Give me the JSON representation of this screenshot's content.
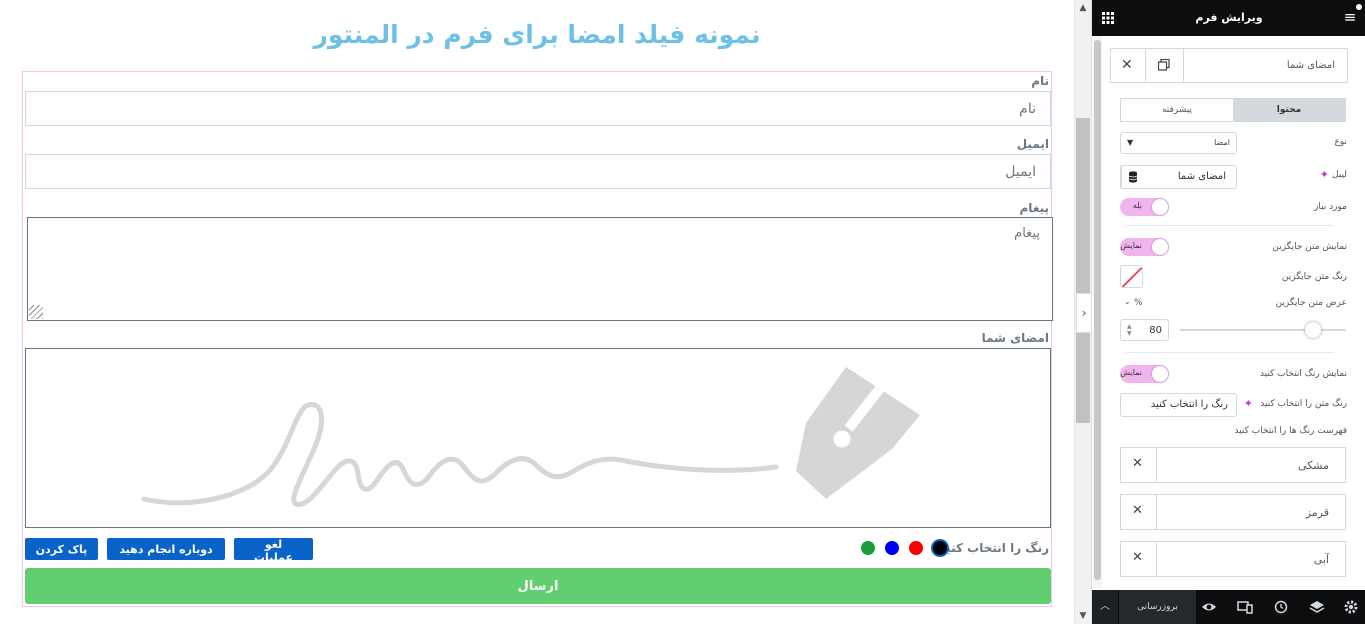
{
  "page": {
    "title": "نمونه فیلد امضا برای فرم در المنتور"
  },
  "form": {
    "name_label": "نام",
    "name_placeholder": "نام",
    "email_label": "ایمیل",
    "email_placeholder": "ایمیل",
    "message_label": "پیغام",
    "message_placeholder": "پیغام",
    "signature_label": "امضای شما",
    "choose_color_label": "رنگ را انتخاب کنید",
    "colors": [
      "#000000",
      "#ff0000",
      "#0000ff",
      "#1b9e3a"
    ],
    "undo_label": "لغو عملیات",
    "redo_label": "دوباره انجام دهید",
    "clear_label": "پاک کردن",
    "submit_label": "ارسال",
    "accent_title_color": "#6ec1e4",
    "submit_color": "#61ce70",
    "button_color": "#0a63c9"
  },
  "panel": {
    "header_title": "ویرایش فرم",
    "item_title": "امضای شما",
    "tabs": {
      "content": "محتوا",
      "advanced": "پیشرفته"
    },
    "fields": {
      "type_label": "نوع",
      "type_value": "امضا",
      "label_label": "لیبل",
      "label_value": "امضای شما",
      "required_label": "مورد نیاز",
      "required_toggle": "بله",
      "show_placeholder_label": "نمایش متن جایگزین",
      "show_placeholder_toggle": "نمایش",
      "placeholder_color_label": "رنگ متن جایگزین",
      "placeholder_width_label": "عرض متن جایگزین",
      "width_unit": "%",
      "width_value": "80",
      "width_percent": 80,
      "show_color_picker_label": "نمایش رنگ انتخاب کنید",
      "show_color_picker_toggle": "نمایش",
      "choose_color_text_label": "رنگ متن را انتخاب کنید",
      "choose_color_text_value": "رنگ را انتخاب کنید",
      "color_list_label": "فهرست رنگ ها را انتخاب کنید",
      "color_items": [
        "مشکی",
        "قرمز",
        "آبی"
      ]
    },
    "footer": {
      "update_label": "بروزرسانی"
    },
    "toggle_color": "#f0b5ee"
  }
}
